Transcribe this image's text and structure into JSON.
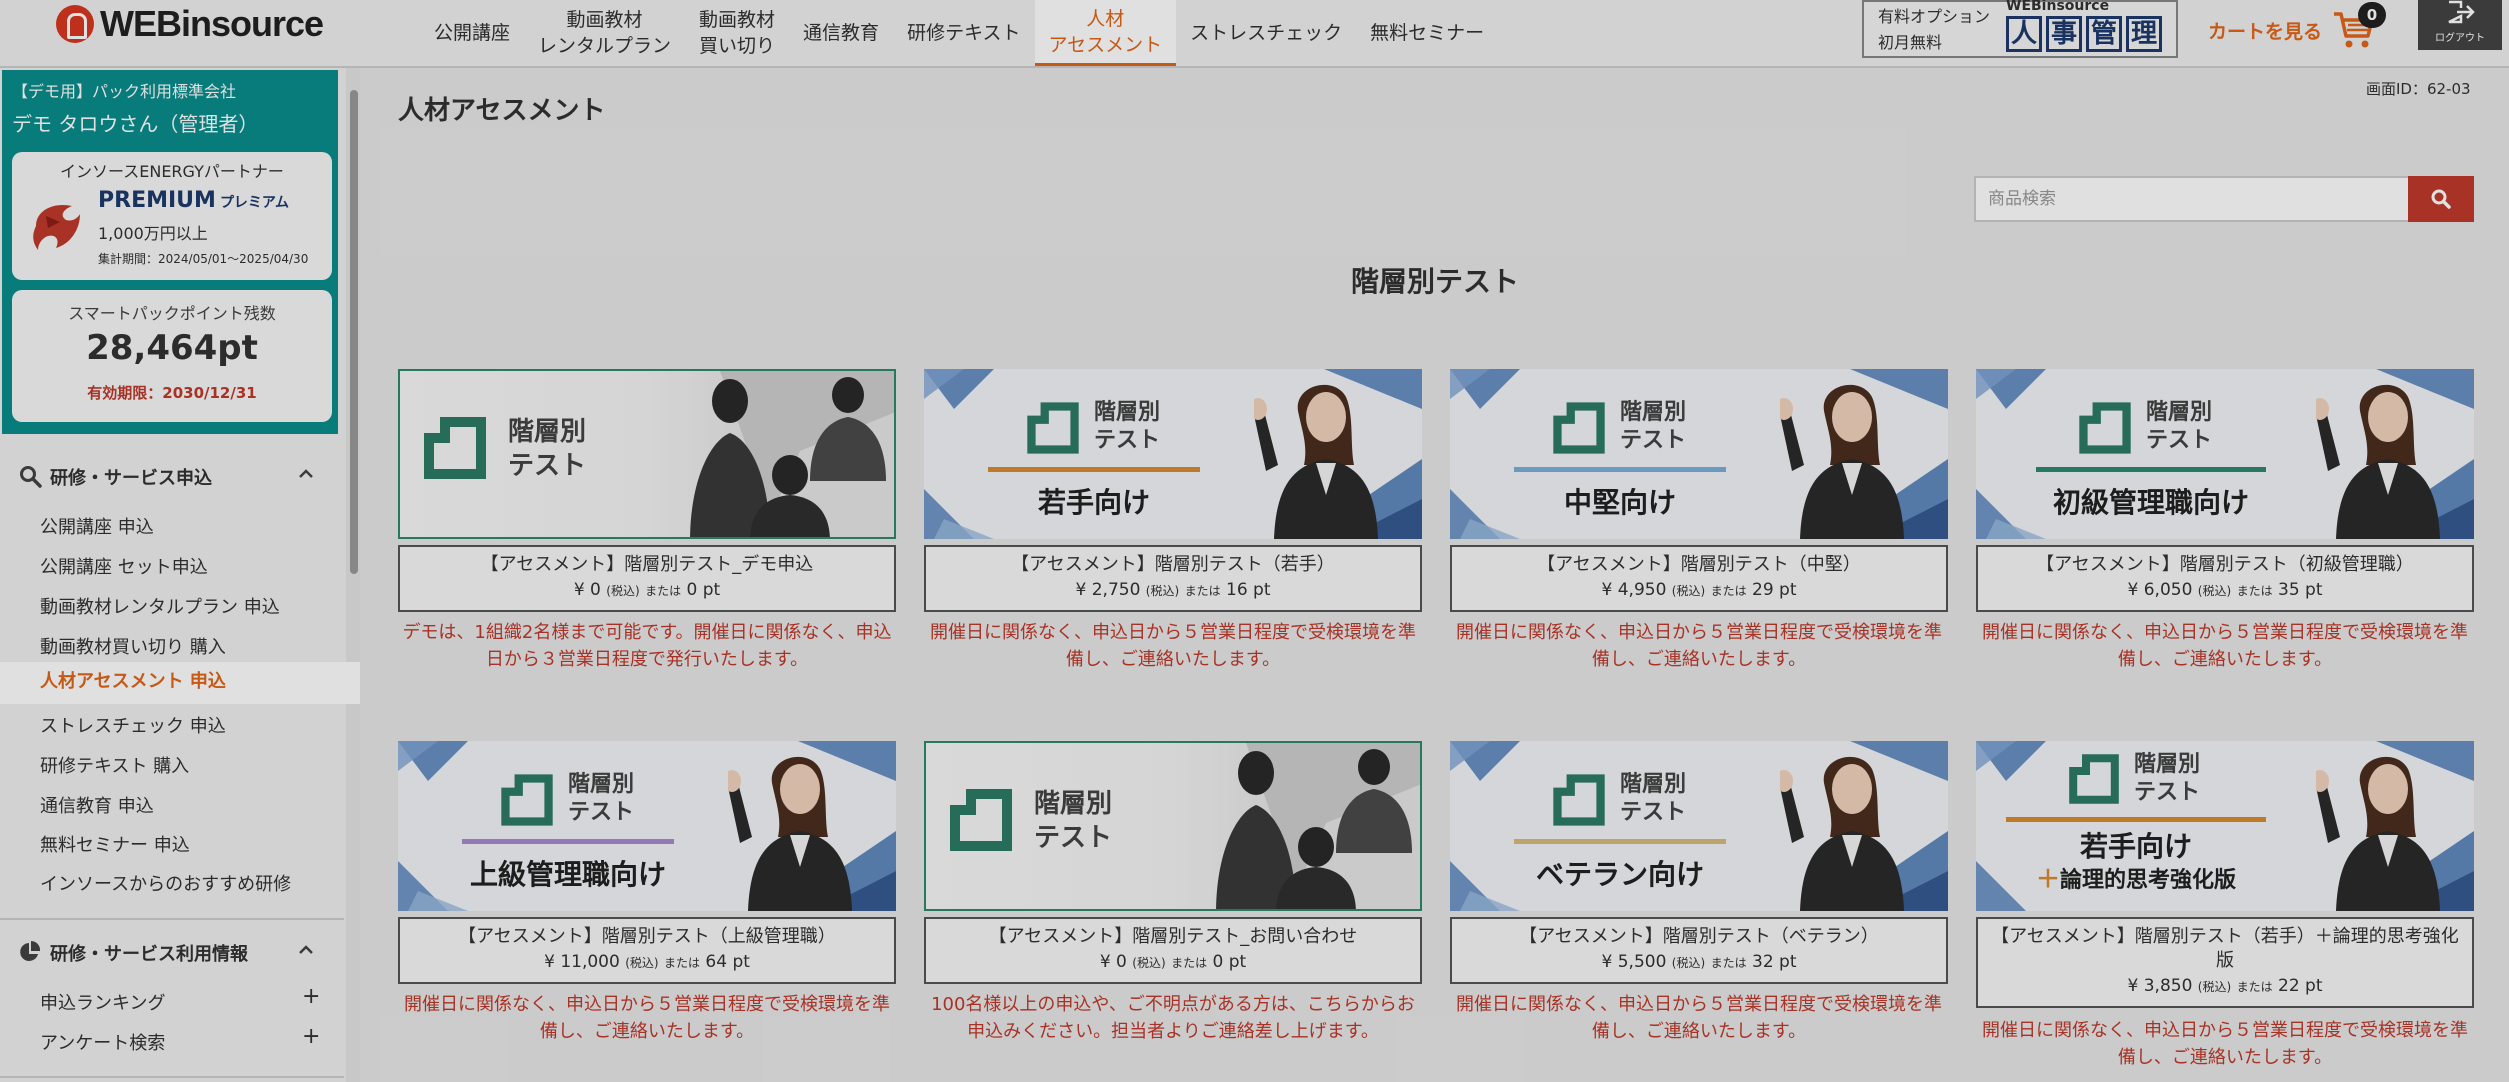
{
  "header": {
    "logo_text": "WEBinsource",
    "nav": [
      {
        "line1": "公開講座",
        "line2": ""
      },
      {
        "line1": "動画教材",
        "line2": "レンタルプラン"
      },
      {
        "line1": "動画教材",
        "line2": "買い切り"
      },
      {
        "line1": "通信教育",
        "line2": ""
      },
      {
        "line1": "研修テキスト",
        "line2": ""
      },
      {
        "line1": "人材",
        "line2": "アセスメント"
      },
      {
        "line1": "ストレスチェック",
        "line2": ""
      },
      {
        "line1": "無料セミナー",
        "line2": ""
      }
    ],
    "option": {
      "line1": "有料オプション",
      "line2": "初月無料",
      "sub": "WEBinsource",
      "chars": [
        "人",
        "事",
        "管",
        "理"
      ]
    },
    "cart_label": "カートを見る",
    "cart_count": "0",
    "logout_label": "ログアウト"
  },
  "sidebar": {
    "company": "【デモ用】パック利用標準会社",
    "username": "デモ タロウさん（管理者）",
    "partner": {
      "title": "インソースENERGYパートナー",
      "rank": "PREMIUM",
      "rank_jp": "プレミアム",
      "amount": "1,000万円以上",
      "period": "集計期間：2024/05/01～2025/04/30"
    },
    "points": {
      "label": "スマートパックポイント残数",
      "value": "28,464pt",
      "expiry": "有効期限：2030/12/31"
    },
    "section1": {
      "label": "研修・サービス申込"
    },
    "items1": [
      "公開講座 申込",
      "公開講座 セット申込",
      "動画教材レンタルプラン 申込",
      "動画教材買い切り 購入",
      "人材アセスメント 申込",
      "ストレスチェック 申込",
      "研修テキスト 購入",
      "通信教育 申込",
      "無料セミナー 申込",
      "インソースからのおすすめ研修"
    ],
    "section2": {
      "label": "研修・サービス利用情報"
    },
    "items2": [
      "申込ランキング",
      "アンケート検索"
    ],
    "plus": "+"
  },
  "main": {
    "page_title": "人材アセスメント",
    "screen_id": "画面ID：62-03",
    "search_placeholder": "商品検索",
    "section_title": "階層別テスト",
    "banner_small_1": "階層別",
    "banner_small_2": "テスト",
    "price_tax": "(税込)",
    "price_or": "または",
    "products": [
      {
        "name": "【アセスメント】階層別テスト_デモ申込",
        "price": "¥ 0",
        "pt": "0 pt",
        "target": "",
        "note": "デモは、1組織2名様まで可能です。開催日に関係なく、申込日から３営業日程度で発行いたします。"
      },
      {
        "name": "【アセスメント】階層別テスト（若手）",
        "price": "¥ 2,750",
        "pt": "16 pt",
        "target": "若手向け",
        "note": "開催日に関係なく、申込日から５営業日程度で受検環境を準備し、ご連絡いたします。"
      },
      {
        "name": "【アセスメント】階層別テスト（中堅）",
        "price": "¥ 4,950",
        "pt": "29 pt",
        "target": "中堅向け",
        "note": "開催日に関係なく、申込日から５営業日程度で受検環境を準備し、ご連絡いたします。"
      },
      {
        "name": "【アセスメント】階層別テスト（初級管理職）",
        "price": "¥ 6,050",
        "pt": "35 pt",
        "target": "初級管理職向け",
        "note": "開催日に関係なく、申込日から５営業日程度で受検環境を準備し、ご連絡いたします。"
      },
      {
        "name": "【アセスメント】階層別テスト（上級管理職）",
        "price": "¥ 11,000",
        "pt": "64 pt",
        "target": "上級管理職向け",
        "note": "開催日に関係なく、申込日から５営業日程度で受検環境を準備し、ご連絡いたします。"
      },
      {
        "name": "【アセスメント】階層別テスト_お問い合わせ",
        "price": "¥ 0",
        "pt": "0 pt",
        "target": "",
        "note": "100名様以上の申込や、ご不明点がある方は、こちらからお申込みください。担当者よりご連絡差し上げます。"
      },
      {
        "name": "【アセスメント】階層別テスト（ベテラン）",
        "price": "¥ 5,500",
        "pt": "32 pt",
        "target": "ベテラン向け",
        "note": "開催日に関係なく、申込日から５営業日程度で受検環境を準備し、ご連絡いたします。"
      },
      {
        "name": "【アセスメント】階層別テスト（若手）＋論理的思考強化版",
        "price": "¥ 3,850",
        "pt": "22 pt",
        "target": "若手向け",
        "target_plus": "＋",
        "target_sub": "論理的思考強化版",
        "note": "開催日に関係なく、申込日から５営業日程度で受検環境を準備し、ご連絡いたします。"
      }
    ]
  },
  "colors": {
    "accent": "#e2661a",
    "teal": "#0a8c8c",
    "danger": "#c0392b",
    "navy": "#1d3a6e"
  }
}
